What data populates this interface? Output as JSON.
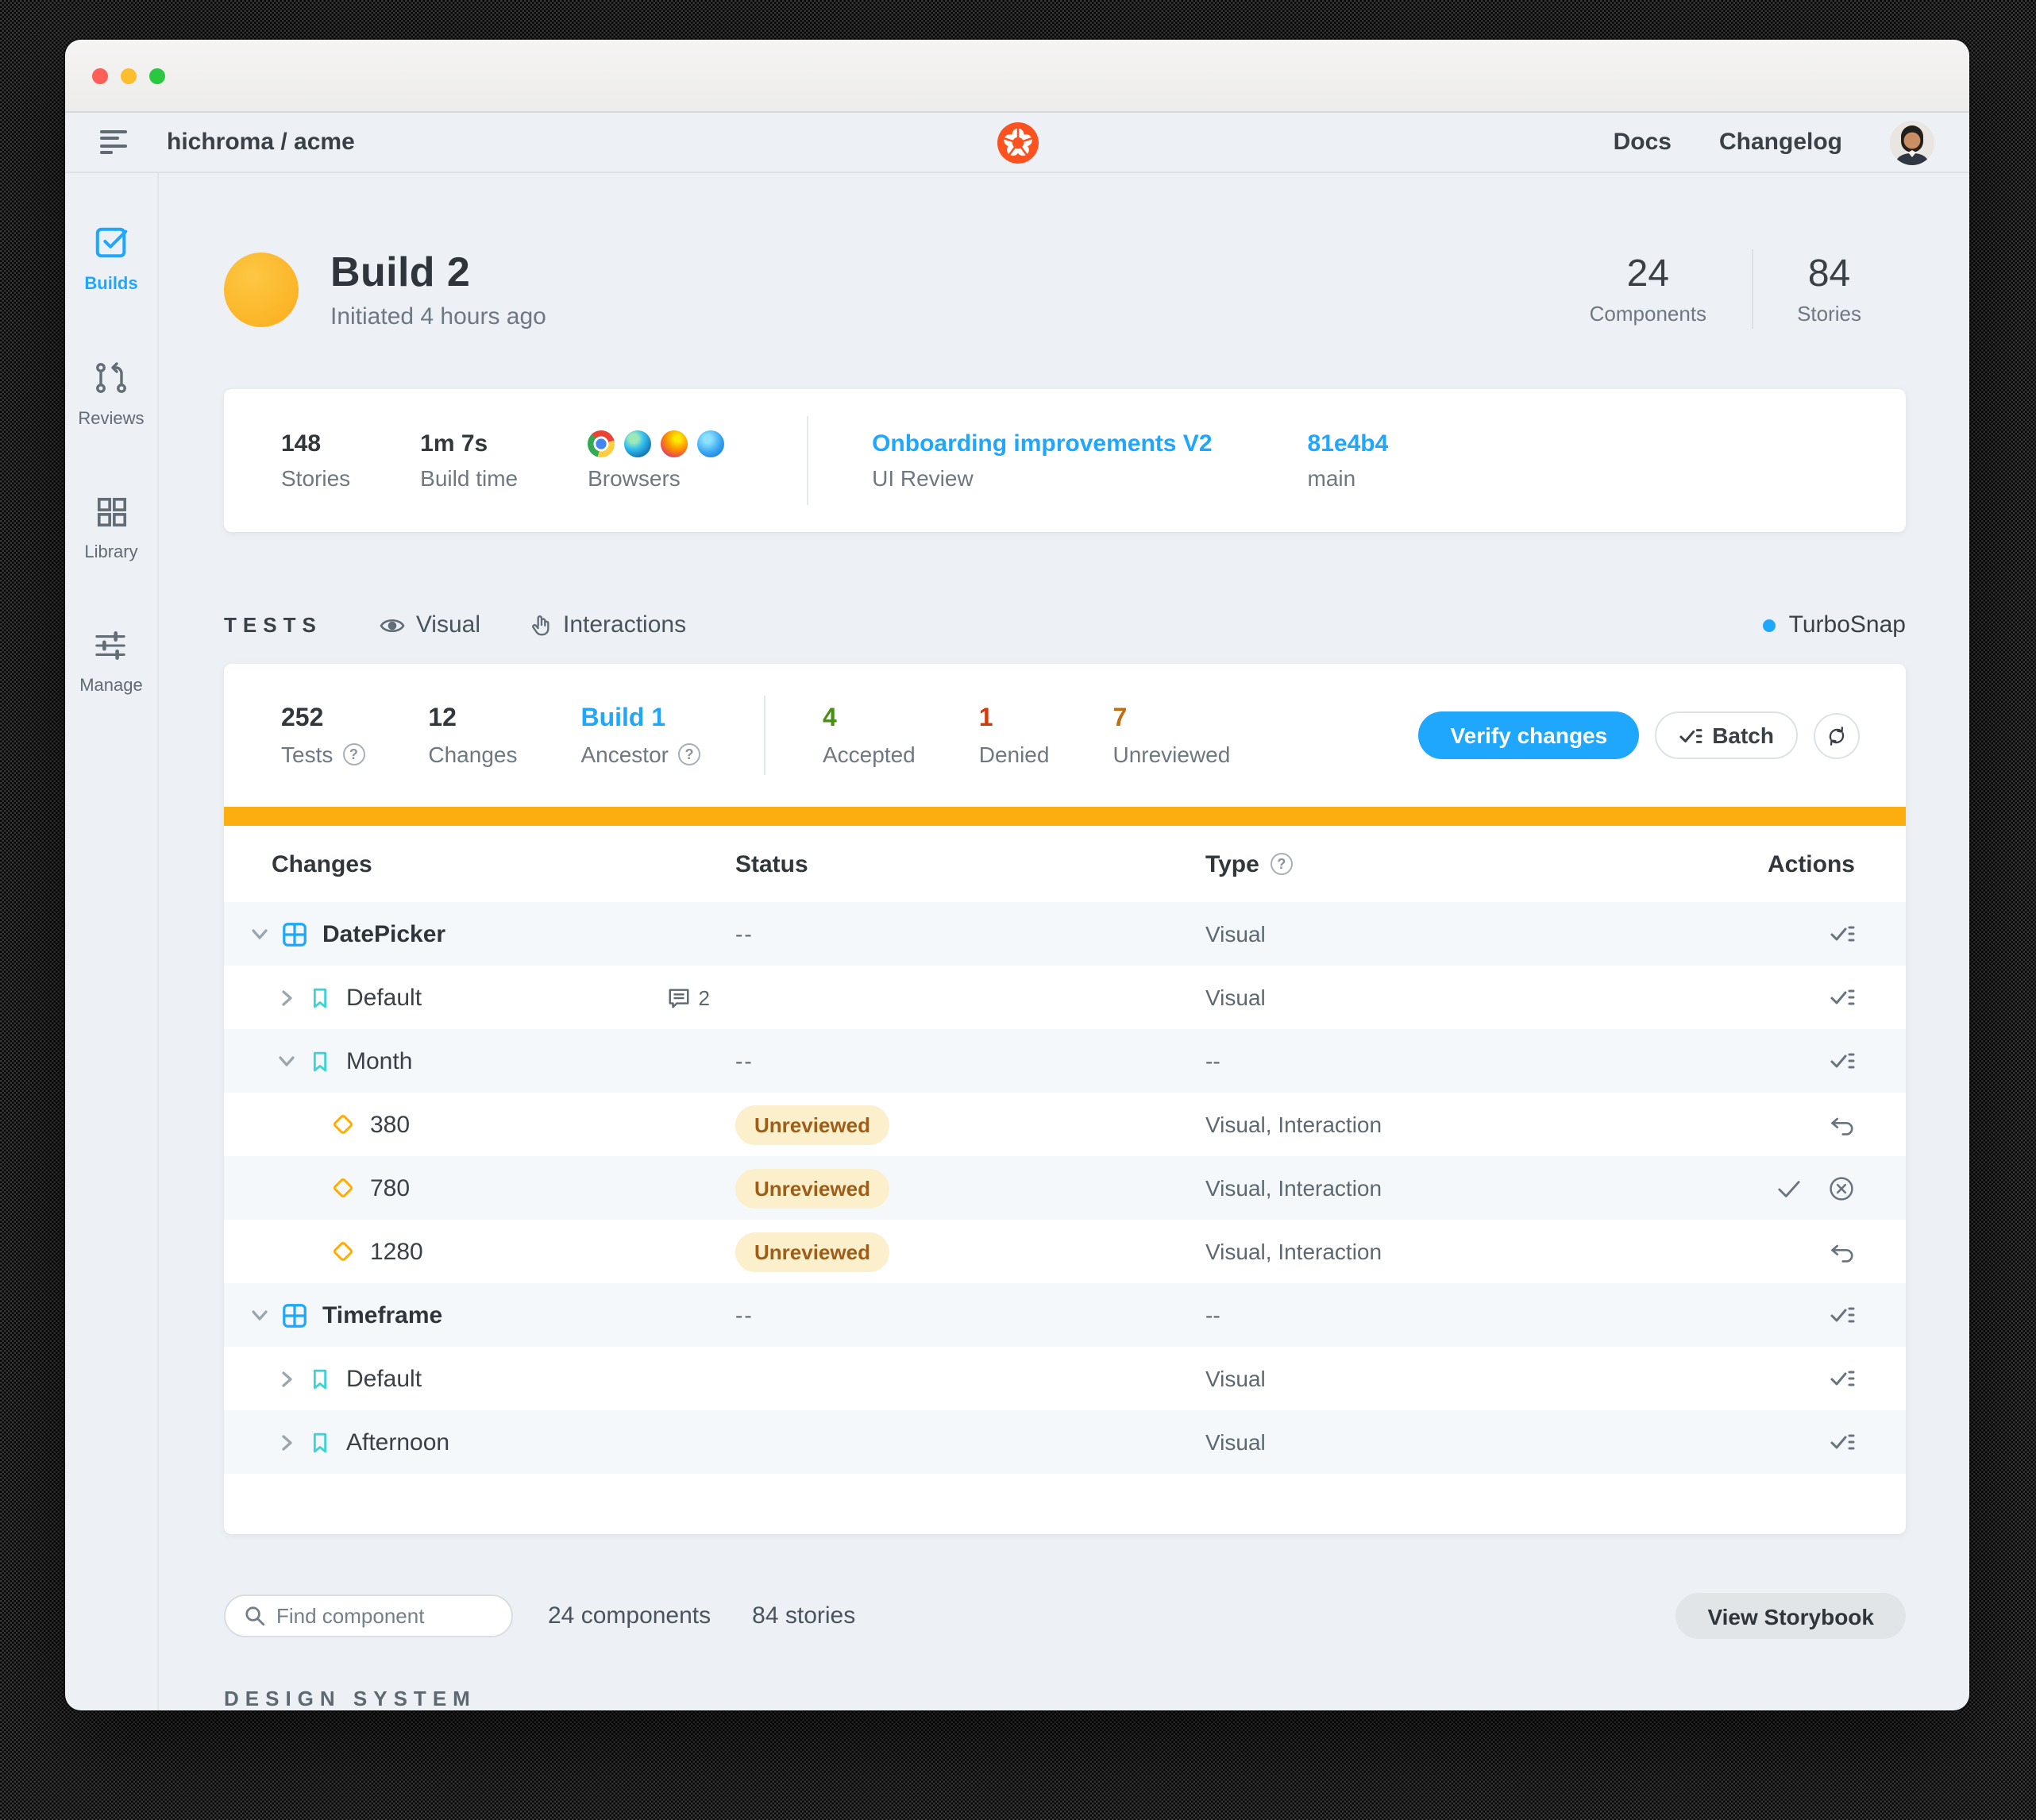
{
  "colors": {
    "accent_blue": "#1EA7FD",
    "gold": "#FFAE00",
    "orange_strip": "#FCAD0F",
    "green": "#4A8F15",
    "red": "#D13A0B",
    "orange_text": "#BF6E0E",
    "logo_orange": "#FC521F",
    "badge_bg": "#FCEFCC",
    "badge_text": "#A05D17"
  },
  "header": {
    "project": "hichroma / acme",
    "nav": [
      "Docs",
      "Changelog"
    ]
  },
  "sidebar": {
    "items": [
      {
        "label": "Builds",
        "icon": "builds-checkbox-icon",
        "active": true
      },
      {
        "label": "Reviews",
        "icon": "reviews-pull-request-icon",
        "active": false
      },
      {
        "label": "Library",
        "icon": "library-grid-icon",
        "active": false
      },
      {
        "label": "Manage",
        "icon": "manage-sliders-icon",
        "active": false
      }
    ]
  },
  "build": {
    "title": "Build 2",
    "subtitle": "Initiated 4 hours ago",
    "stats": [
      {
        "value": "24",
        "label": "Components"
      },
      {
        "value": "84",
        "label": "Stories"
      }
    ]
  },
  "info_card": {
    "stories": {
      "value": "148",
      "label": "Stories"
    },
    "build_time": {
      "value": "1m 7s",
      "label": "Build time"
    },
    "browsers": {
      "label": "Browsers",
      "icons": [
        "chrome-icon",
        "edge-icon",
        "firefox-icon",
        "safari-icon"
      ]
    },
    "review": {
      "value": "Onboarding improvements V2",
      "label": "UI Review"
    },
    "commit": {
      "value": "81e4b4",
      "label": "main"
    }
  },
  "tests_section": {
    "heading": "TESTS",
    "tabs": [
      {
        "label": "Visual",
        "icon": "eye-icon"
      },
      {
        "label": "Interactions",
        "icon": "hand-icon"
      }
    ],
    "turbosnap": "TurboSnap"
  },
  "summary": {
    "stats": [
      {
        "value": "252",
        "label": "Tests",
        "help": true,
        "color": "dark"
      },
      {
        "value": "12",
        "label": "Changes",
        "color": "dark"
      },
      {
        "value": "Build 1",
        "label": "Ancestor",
        "help": true,
        "color": "blue"
      },
      {
        "value": "4",
        "label": "Accepted",
        "color": "green"
      },
      {
        "value": "1",
        "label": "Denied",
        "color": "red"
      },
      {
        "value": "7",
        "label": "Unreviewed",
        "color": "orange"
      }
    ],
    "divider_after_index": 2,
    "verify_button": "Verify changes",
    "batch_button": "Batch"
  },
  "table": {
    "columns": [
      "Changes",
      "Status",
      "Type",
      "Actions"
    ],
    "rows": [
      {
        "kind": "component",
        "name": "DatePicker",
        "chevron": "down",
        "icon": "component-grid-icon",
        "status": "dashes",
        "type": "Visual",
        "actions": [
          "batch"
        ]
      },
      {
        "kind": "story",
        "name": "Default",
        "chevron": "right",
        "icon": "story-bookmark-icon",
        "status": "bar",
        "comments": "2",
        "type": "Visual",
        "actions": [
          "batch"
        ]
      },
      {
        "kind": "story",
        "name": "Month",
        "chevron": "down",
        "icon": "story-bookmark-icon",
        "status": "dashes",
        "type": "--",
        "actions": [
          "batch"
        ]
      },
      {
        "kind": "variant",
        "name": "380",
        "icon": "variant-diamond-icon",
        "status": "badge",
        "badge": "Unreviewed",
        "type": "Visual, Interaction",
        "actions": [
          "undo"
        ]
      },
      {
        "kind": "variant",
        "name": "780",
        "icon": "variant-diamond-icon",
        "status": "badge",
        "badge": "Unreviewed",
        "type": "Visual, Interaction",
        "actions": [
          "accept",
          "deny"
        ]
      },
      {
        "kind": "variant",
        "name": "1280",
        "icon": "variant-diamond-icon",
        "status": "badge",
        "badge": "Unreviewed",
        "type": "Visual, Interaction",
        "actions": [
          "undo"
        ]
      },
      {
        "kind": "component",
        "name": "Timeframe",
        "chevron": "down",
        "icon": "component-grid-icon",
        "status": "dashes",
        "type": "--",
        "actions": [
          "batch"
        ]
      },
      {
        "kind": "story",
        "name": "Default",
        "chevron": "right",
        "icon": "story-bookmark-icon",
        "status": "bar",
        "type": "Visual",
        "actions": [
          "batch"
        ]
      },
      {
        "kind": "story",
        "name": "Afternoon",
        "chevron": "right",
        "icon": "story-bookmark-icon",
        "status": "bar",
        "type": "Visual",
        "actions": [
          "batch"
        ]
      }
    ]
  },
  "footer": {
    "search_placeholder": "Find component",
    "counts": [
      "24 components",
      "84 stories"
    ],
    "view_storybook": "View Storybook",
    "design_system": "DESIGN SYSTEM"
  }
}
